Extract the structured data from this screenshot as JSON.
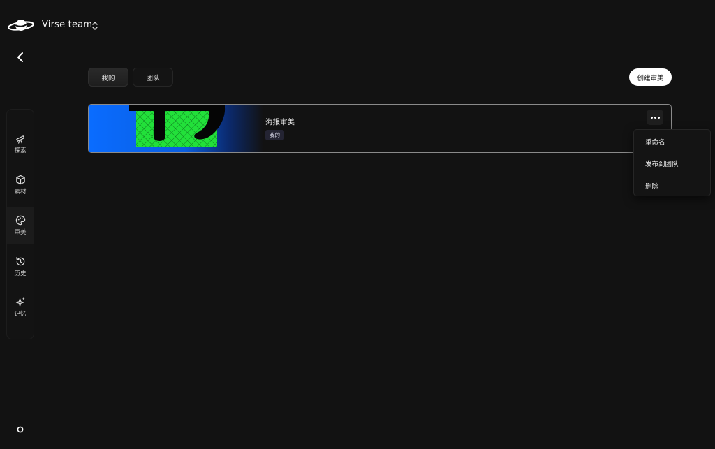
{
  "header": {
    "team_name": "Virse team",
    "logo_icon": "planet-logo-icon",
    "switch_icon": "chevron-updown-icon",
    "back_icon": "chevron-left-icon"
  },
  "sidebar": {
    "items": [
      {
        "label": "探索",
        "icon": "telescope-icon",
        "active": false
      },
      {
        "label": "素材",
        "icon": "cube-icon",
        "active": false
      },
      {
        "label": "审美",
        "icon": "palette-icon",
        "active": true
      },
      {
        "label": "历史",
        "icon": "history-icon",
        "active": false
      },
      {
        "label": "记忆",
        "icon": "sparkle-icon",
        "active": false
      }
    ],
    "bottom_icon": "circle-icon"
  },
  "tabs": [
    {
      "label": "我的",
      "selected": true
    },
    {
      "label": "团队",
      "selected": false
    }
  ],
  "create_button": {
    "label": "创建审美"
  },
  "cards": [
    {
      "title": "海报审美",
      "badge": "我的"
    }
  ],
  "context_menu": {
    "items": [
      "重命名",
      "发布到团队",
      "删除"
    ]
  },
  "colors": {
    "background": "#121212",
    "thumb_blue": "#0a6cff",
    "thumb_green": "#22e03a",
    "badge_bg": "#242433"
  }
}
